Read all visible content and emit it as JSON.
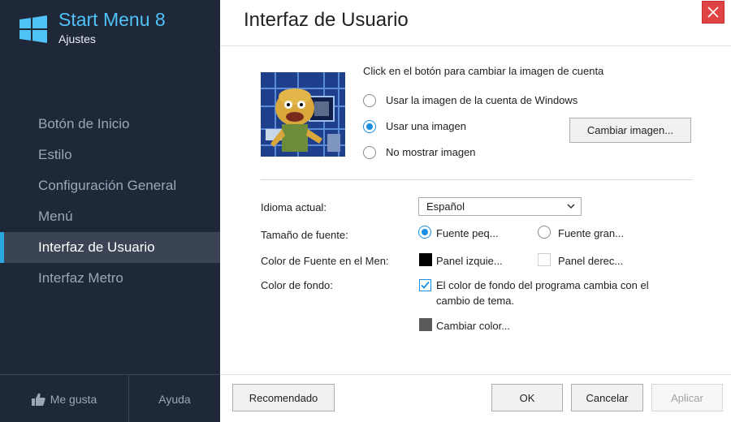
{
  "app": {
    "title": "Start Menu 8",
    "subtitle": "Ajustes"
  },
  "nav": {
    "items": [
      {
        "label": "Botón de Inicio"
      },
      {
        "label": "Estilo"
      },
      {
        "label": "Configuración General"
      },
      {
        "label": "Menú"
      },
      {
        "label": "Interfaz de Usuario",
        "active": true
      },
      {
        "label": "Interfaz Metro"
      }
    ]
  },
  "footer": {
    "like_label": "Me gusta",
    "help_label": "Ayuda"
  },
  "page": {
    "title": "Interfaz de Usuario"
  },
  "account_image": {
    "instruction": "Click en el botón para cambiar la imagen de cuenta",
    "options": [
      {
        "label": "Usar la imagen de la cuenta de Windows",
        "selected": false
      },
      {
        "label": "Usar una imagen",
        "selected": true
      },
      {
        "label": "No mostrar imagen",
        "selected": false
      }
    ],
    "change_button": "Cambiar imagen..."
  },
  "settings": {
    "language_label": "Idioma actual:",
    "language_value": "Español",
    "font_size_label": "Tamaño de fuente:",
    "font_small": "Fuente peq...",
    "font_large": "Fuente gran...",
    "font_color_label": "Color de Fuente en el Men:",
    "left_panel": "Panel izquie...",
    "right_panel": "Panel derec...",
    "bg_color_label": "Color de fondo:",
    "bg_checkbox_line1": "El color de fondo del programa cambia con el",
    "bg_checkbox_line2": "cambio de tema.",
    "change_color": "Cambiar color..."
  },
  "buttons": {
    "recommended": "Recomendado",
    "ok": "OK",
    "cancel": "Cancelar",
    "apply": "Aplicar"
  },
  "colors": {
    "accent": "#29a8e0",
    "sidebar": "#1f2838",
    "close": "#e04343",
    "swatch_left": "#000000",
    "swatch_right": "#ffffff",
    "swatch_bg": "#5a5a5a"
  }
}
